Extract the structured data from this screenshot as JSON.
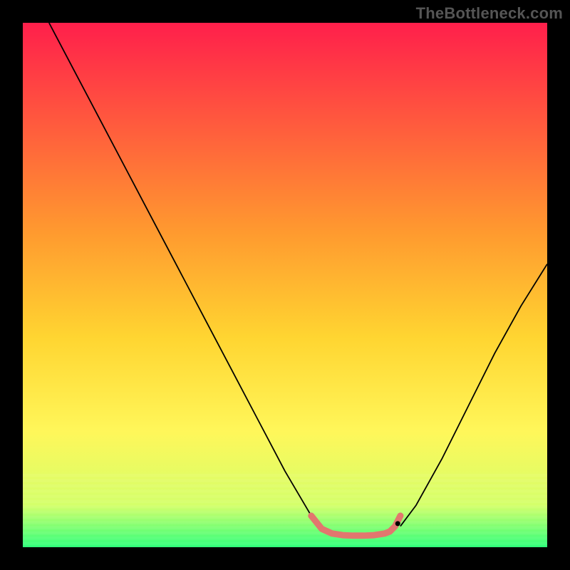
{
  "watermark": "TheBottleneck.com",
  "chart_data": {
    "type": "line",
    "title": "",
    "xlabel": "",
    "ylabel": "",
    "xlim": [
      0,
      100
    ],
    "ylim": [
      0,
      100
    ],
    "background_gradient": {
      "stops": [
        {
          "offset": 0.0,
          "color": "#ff1f4b"
        },
        {
          "offset": 0.4,
          "color": "#ff9a2f"
        },
        {
          "offset": 0.6,
          "color": "#ffd531"
        },
        {
          "offset": 0.78,
          "color": "#fff75a"
        },
        {
          "offset": 0.92,
          "color": "#d4ff6a"
        },
        {
          "offset": 1.0,
          "color": "#2fff7a"
        }
      ]
    },
    "series": [
      {
        "name": "curve-left",
        "color": "#000000",
        "width": 1.8,
        "x": [
          5,
          10,
          15,
          20,
          25,
          30,
          35,
          40,
          45,
          50,
          55,
          57
        ],
        "y": [
          100,
          90.5,
          81,
          71.5,
          62,
          52.5,
          43,
          33.5,
          24,
          14.5,
          6,
          4
        ]
      },
      {
        "name": "curve-right",
        "color": "#000000",
        "width": 1.8,
        "x": [
          72,
          75,
          80,
          85,
          90,
          95,
          100
        ],
        "y": [
          4,
          8,
          17,
          27,
          37,
          46,
          54
        ]
      },
      {
        "name": "flat-bottom",
        "color": "#e2766e",
        "width": 9,
        "linecap": "round",
        "x": [
          55,
          57,
          59,
          61,
          63,
          65,
          67,
          69,
          70,
          71,
          72
        ],
        "y": [
          6,
          3.5,
          2.6,
          2.3,
          2.2,
          2.2,
          2.3,
          2.6,
          3.0,
          4.0,
          6
        ]
      }
    ],
    "markers": [
      {
        "name": "black-dot",
        "x": 71.5,
        "y": 4.5,
        "r": 3.5,
        "color": "#000000"
      }
    ]
  }
}
